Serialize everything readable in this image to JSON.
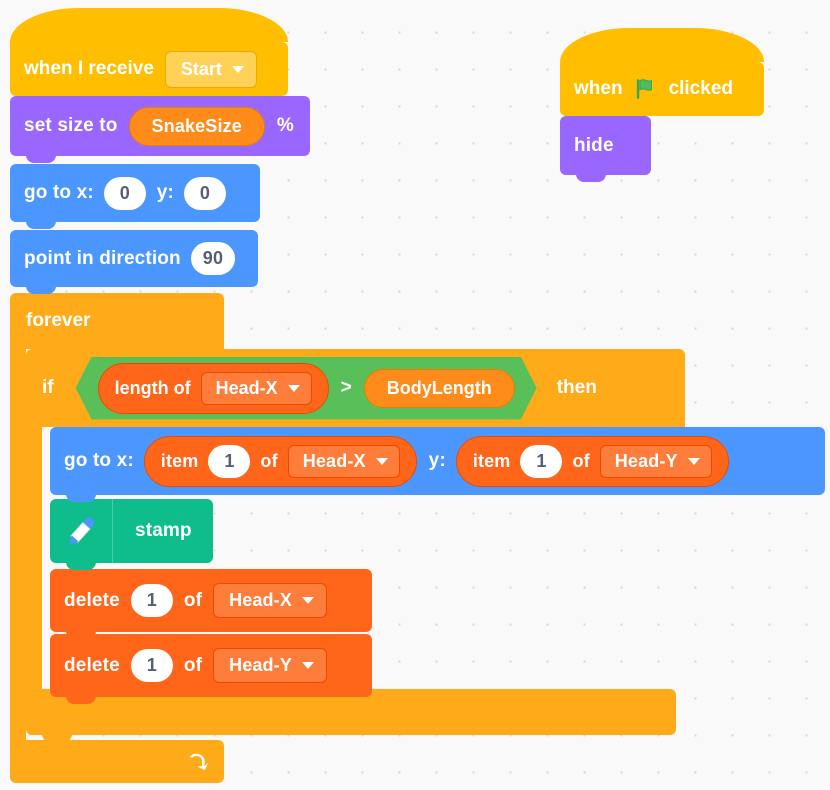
{
  "workspace": {
    "background_color": "#f9f9f9",
    "dot_color": "#d9d9dd"
  },
  "colors": {
    "events": "#ffbf00",
    "looks": "#9966ff",
    "motion": "#4c97ff",
    "control": "#ffab19",
    "pen": "#0fbd8c",
    "list": "#ff661a",
    "variables": "#ff8c1a",
    "operators": "#59c059",
    "input_white": "#ffffff",
    "input_text": "#575e75"
  },
  "scripts": {
    "main": {
      "hat": {
        "label": "when I receive",
        "dropdown_value": "Start",
        "dropdown_icon": "chevron-down-icon"
      },
      "set_size": {
        "label": "set size to",
        "variable": "SnakeSize",
        "suffix": "%"
      },
      "go_to_origin": {
        "label_x": "go to x:",
        "value_x": "0",
        "label_y": "y:",
        "value_y": "0"
      },
      "point_in_direction": {
        "label": "point in direction",
        "value": "90"
      },
      "forever": {
        "label": "forever",
        "loop_icon": "loop-arrow-icon"
      },
      "if_block": {
        "label_if": "if",
        "label_then": "then",
        "condition": {
          "left": {
            "label": "length of",
            "list": "Head-X",
            "dropdown_icon": "chevron-down-icon"
          },
          "operator": ">",
          "right": {
            "variable": "BodyLength"
          }
        }
      },
      "go_to_head": {
        "label_x": "go to x:",
        "label_y": "y:",
        "item_x": {
          "label_item": "item",
          "index": "1",
          "label_of": "of",
          "list": "Head-X",
          "dropdown_icon": "chevron-down-icon"
        },
        "item_y": {
          "label_item": "item",
          "index": "1",
          "label_of": "of",
          "list": "Head-Y",
          "dropdown_icon": "chevron-down-icon"
        }
      },
      "stamp": {
        "label": "stamp",
        "icon": "pen-icon"
      },
      "delete_x": {
        "label_delete": "delete",
        "index": "1",
        "label_of": "of",
        "list": "Head-X",
        "dropdown_icon": "chevron-down-icon"
      },
      "delete_y": {
        "label_delete": "delete",
        "index": "1",
        "label_of": "of",
        "list": "Head-Y",
        "dropdown_icon": "chevron-down-icon"
      }
    },
    "secondary": {
      "hat": {
        "label_before": "when",
        "icon": "green-flag-icon",
        "label_after": "clicked"
      },
      "hide": {
        "label": "hide"
      }
    }
  }
}
